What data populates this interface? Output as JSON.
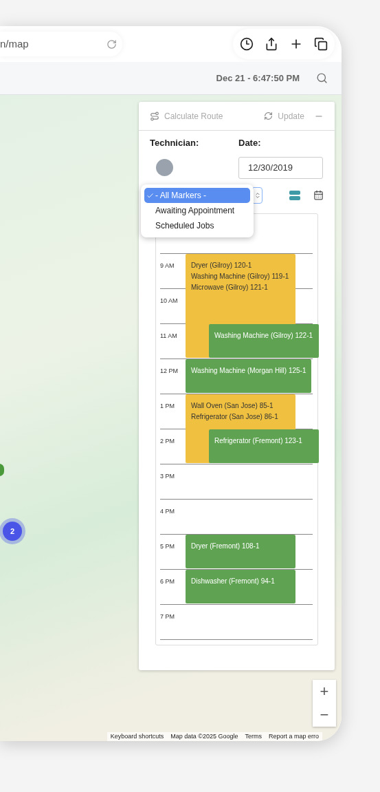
{
  "browser": {
    "url": "n/map"
  },
  "header": {
    "datetime": "Dec 21 - 6:47:50 PM"
  },
  "map": {
    "cluster_count": "2",
    "zoom_in": "+",
    "zoom_out": "−",
    "attribution": [
      "Keyboard shortcuts",
      "Map data ©2025 Google",
      "Terms",
      "Report a map erro"
    ]
  },
  "panel": {
    "calculate_route": "Calculate Route",
    "update": "Update",
    "technician_label": "Technician:",
    "date_label": "Date:",
    "date_value": "12/30/2019",
    "marker_menu": [
      {
        "label": "- All Markers -",
        "selected": true
      },
      {
        "label": "Awaiting Appointment",
        "selected": false
      },
      {
        "label": "Scheduled Jobs",
        "selected": false
      }
    ],
    "hours": [
      {
        "label": "9 AM",
        "events": [
          {
            "kind": "triple",
            "color": "#f0c040",
            "lines": [
              "Dryer (Gilroy) 120-1",
              "Washing Machine (Gilroy) 119-1",
              "Microwave (Gilroy) 121-1"
            ]
          }
        ]
      },
      {
        "label": "10 AM"
      },
      {
        "label": "11 AM",
        "events": [
          {
            "kind": "overlap",
            "color": "#5fa352",
            "lines": [
              "Washing Machine (Gilroy) 122-1"
            ]
          }
        ]
      },
      {
        "label": "12 PM",
        "events": [
          {
            "kind": "wide",
            "color": "#5fa352",
            "lines": [
              "Washing Machine (Morgan Hill) 125-1"
            ]
          }
        ]
      },
      {
        "label": "1 PM",
        "events": [
          {
            "kind": "double",
            "color": "#f0c040",
            "lines": [
              "Wall Oven (San Jose) 85-1",
              "Refrigerator (San Jose) 86-1"
            ]
          }
        ]
      },
      {
        "label": "2 PM",
        "events": [
          {
            "kind": "overlap",
            "color": "#5fa352",
            "lines": [
              "Refrigerator (Fremont) 123-1"
            ]
          }
        ]
      },
      {
        "label": "3 PM"
      },
      {
        "label": "4 PM"
      },
      {
        "label": "5 PM",
        "events": [
          {
            "kind": "single",
            "color": "#5fa352",
            "lines": [
              "Dryer (Fremont) 108-1"
            ]
          }
        ]
      },
      {
        "label": "6 PM",
        "events": [
          {
            "kind": "single",
            "color": "#5fa352",
            "lines": [
              "Dishwasher (Fremont) 94-1"
            ]
          }
        ]
      },
      {
        "label": "7 PM"
      }
    ]
  }
}
